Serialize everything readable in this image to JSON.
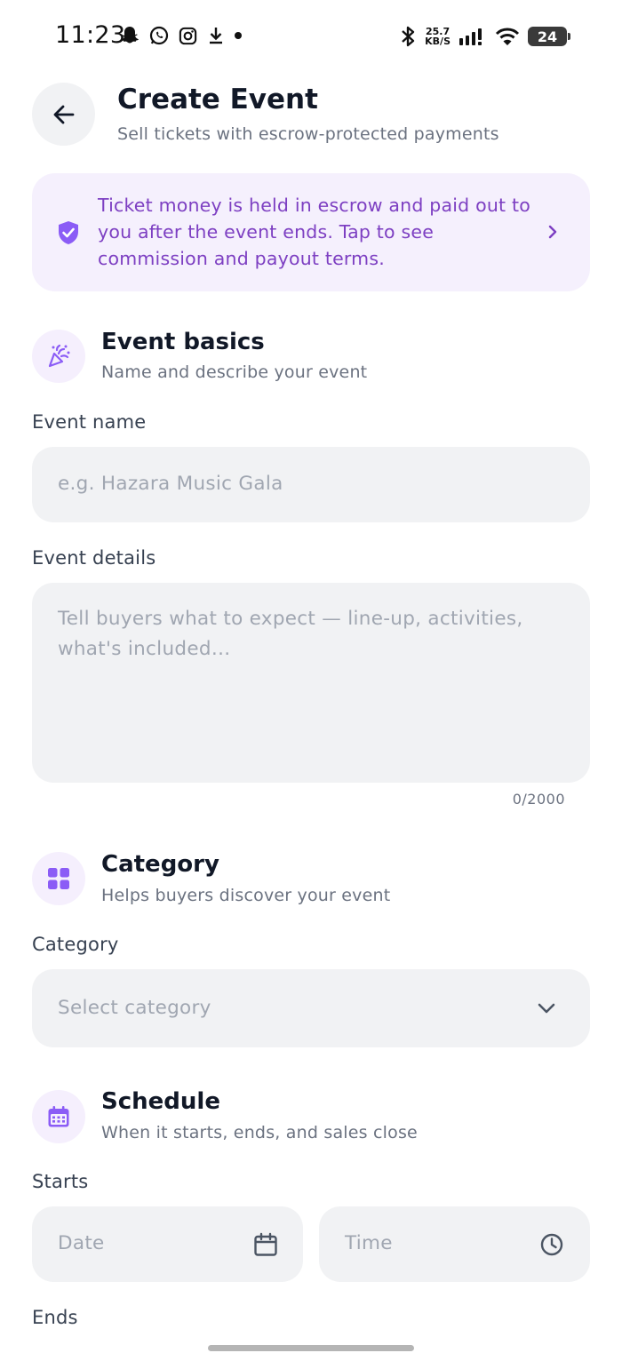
{
  "status_bar": {
    "time": "11:23",
    "net_speed_value": "25.7",
    "net_speed_unit": "KB/S",
    "battery": "24"
  },
  "header": {
    "title": "Create Event",
    "subtitle": "Sell tickets with escrow-protected payments"
  },
  "banner": {
    "text": "Ticket money is held in escrow and paid out to you after the event ends. Tap to see commission and payout terms."
  },
  "sections": {
    "basics": {
      "title": "Event basics",
      "description": "Name and describe your event",
      "name_label": "Event name",
      "name_placeholder": "e.g. Hazara Music Gala",
      "details_label": "Event details",
      "details_placeholder": "Tell buyers what to expect — line-up, activities, what's included…",
      "details_counter": "0/2000"
    },
    "category": {
      "title": "Category",
      "description": "Helps buyers discover your event",
      "label": "Category",
      "placeholder": "Select category"
    },
    "schedule": {
      "title": "Schedule",
      "description": "When it starts, ends, and sales close",
      "starts_label": "Starts",
      "date_placeholder": "Date",
      "time_placeholder": "Time",
      "ends_label": "Ends"
    }
  },
  "colors": {
    "accent": "#7d3fc2",
    "accent_icon": "#8b5cf6",
    "banner_bg": "#f5f0fd",
    "field_bg": "#f1f2f4"
  },
  "icons": {
    "back": "arrow-left-icon",
    "banner_shield": "shield-check-icon",
    "banner_chevron": "chevron-right-icon",
    "basics": "party-popper-icon",
    "category": "grid-icon",
    "schedule": "calendar-icon",
    "category_dropdown": "chevron-down-icon",
    "date": "calendar-icon",
    "time": "clock-icon"
  }
}
